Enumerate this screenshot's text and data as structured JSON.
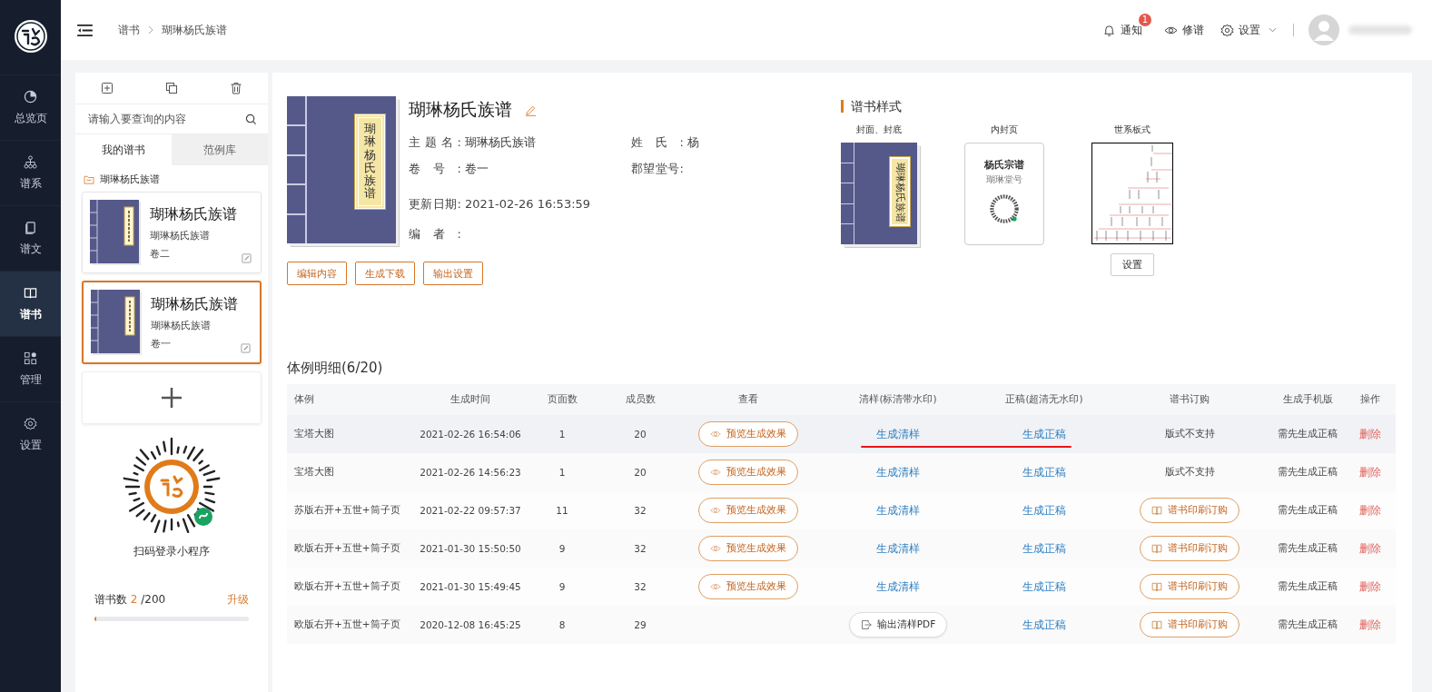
{
  "nav": [
    {
      "kind": "pie",
      "label": "总览页",
      "selected": false
    },
    {
      "kind": "tree",
      "label": "谱系",
      "selected": false
    },
    {
      "kind": "doc",
      "label": "谱文",
      "selected": false
    },
    {
      "kind": "book",
      "label": "谱书",
      "selected": true
    },
    {
      "kind": "grid",
      "label": "管理",
      "selected": false
    },
    {
      "kind": "gear",
      "label": "设置",
      "selected": false
    }
  ],
  "breadcrumb": [
    "谱书",
    "瑚琳杨氏族谱"
  ],
  "header": {
    "notify": "通知",
    "badge": "1",
    "revise": "修谱",
    "settings": "设置"
  },
  "library": {
    "search_placeholder": "请输入要查询的内容",
    "tabs": [
      {
        "label": "我的谱书",
        "selected": true
      },
      {
        "label": "范例库",
        "selected": false
      }
    ],
    "folder": "瑚琳杨氏族谱",
    "books": [
      {
        "title": "瑚琳杨氏族谱",
        "subtitle": "瑚琳杨氏族谱",
        "volume": "卷二",
        "selected": false
      },
      {
        "title": "瑚琳杨氏族谱",
        "subtitle": "瑚琳杨氏族谱",
        "volume": "卷一",
        "selected": true
      }
    ],
    "qr_caption": "扫码登录小程序",
    "quota": {
      "label": "谱书数",
      "used": "2",
      "total": "/200",
      "level": 0.01,
      "upgrade": "升级"
    }
  },
  "book": {
    "cover_label": "瑚琳杨氏族谱",
    "title": "瑚琳杨氏族谱",
    "fields": [
      {
        "label": "主题名:",
        "value": "瑚琳杨氏族谱"
      },
      {
        "label": "姓氏:",
        "value": "杨"
      },
      {
        "label": "卷号:",
        "value": "卷一"
      },
      {
        "label": "郡望堂号:"
      },
      {
        "label": "更新日期:",
        "value": "2021-02-26 16:53:59"
      },
      {
        "label": "编者:"
      }
    ],
    "buttons": [
      "编辑内容",
      "生成下载",
      "输出设置"
    ]
  },
  "styles": {
    "title": "谱书样式",
    "items": [
      {
        "kind": "cover",
        "label": "封面、封底",
        "cover_text": "瑚琳杨氏族谱"
      },
      {
        "kind": "inner",
        "label": "内封页",
        "heading": "杨氏宗谱",
        "subheading": "瑚琳堂号"
      },
      {
        "kind": "tree",
        "label": "世系板式",
        "button": "设置"
      }
    ]
  },
  "table": {
    "title": "体例明细(6/20)",
    "columns": [
      "体例",
      "生成时间",
      "页面数",
      "成员数",
      "查看",
      "清样(标清带水印)",
      "正稿(超清无水印)",
      "谱书订购",
      "生成手机版",
      "操作"
    ],
    "rows": [
      {
        "name": "宝塔大图",
        "time": "2021-02-26 16:54:06",
        "pages": "1",
        "members": "20",
        "preview": "预览生成效果",
        "sample": {
          "kind": "link",
          "label": "生成清样"
        },
        "final": "生成正稿",
        "order": {
          "kind": "text",
          "label": "版式不支持"
        },
        "mobile": "需先生成正稿",
        "action": "删除",
        "highlighted": true,
        "underlined": true
      },
      {
        "name": "宝塔大图",
        "time": "2021-02-26 14:56:23",
        "pages": "1",
        "members": "20",
        "preview": "预览生成效果",
        "sample": {
          "kind": "link",
          "label": "生成清样"
        },
        "final": "生成正稿",
        "order": {
          "kind": "text",
          "label": "版式不支持"
        },
        "mobile": "需先生成正稿",
        "action": "删除",
        "highlighted": false,
        "underlined": false
      },
      {
        "name": "苏版右开+五世+筒子页",
        "time": "2021-02-22 09:57:37",
        "pages": "11",
        "members": "32",
        "preview": "预览生成效果",
        "sample": {
          "kind": "link",
          "label": "生成清样"
        },
        "final": "生成正稿",
        "order": {
          "kind": "button",
          "label": "谱书印刷订购"
        },
        "mobile": "需先生成正稿",
        "action": "删除",
        "highlighted": false,
        "underlined": false
      },
      {
        "name": "欧版右开+五世+筒子页",
        "time": "2021-01-30 15:50:50",
        "pages": "9",
        "members": "32",
        "preview": "预览生成效果",
        "sample": {
          "kind": "link",
          "label": "生成清样"
        },
        "final": "生成正稿",
        "order": {
          "kind": "button",
          "label": "谱书印刷订购"
        },
        "mobile": "需先生成正稿",
        "action": "删除",
        "highlighted": false,
        "underlined": false
      },
      {
        "name": "欧版右开+五世+筒子页",
        "time": "2021-01-30 15:49:45",
        "pages": "9",
        "members": "32",
        "preview": "预览生成效果",
        "sample": {
          "kind": "link",
          "label": "生成清样"
        },
        "final": "生成正稿",
        "order": {
          "kind": "button",
          "label": "谱书印刷订购"
        },
        "mobile": "需先生成正稿",
        "action": "删除",
        "highlighted": false,
        "underlined": false
      },
      {
        "name": "欧版右开+五世+筒子页",
        "time": "2020-12-08 16:45:25",
        "pages": "8",
        "members": "29",
        "sample": {
          "kind": "button",
          "label": "输出清样PDF"
        },
        "final": "生成正稿",
        "order": {
          "kind": "button",
          "label": "谱书印刷订购"
        },
        "mobile": "需先生成正稿",
        "action": "删除",
        "highlighted": false,
        "underlined": false
      }
    ]
  }
}
